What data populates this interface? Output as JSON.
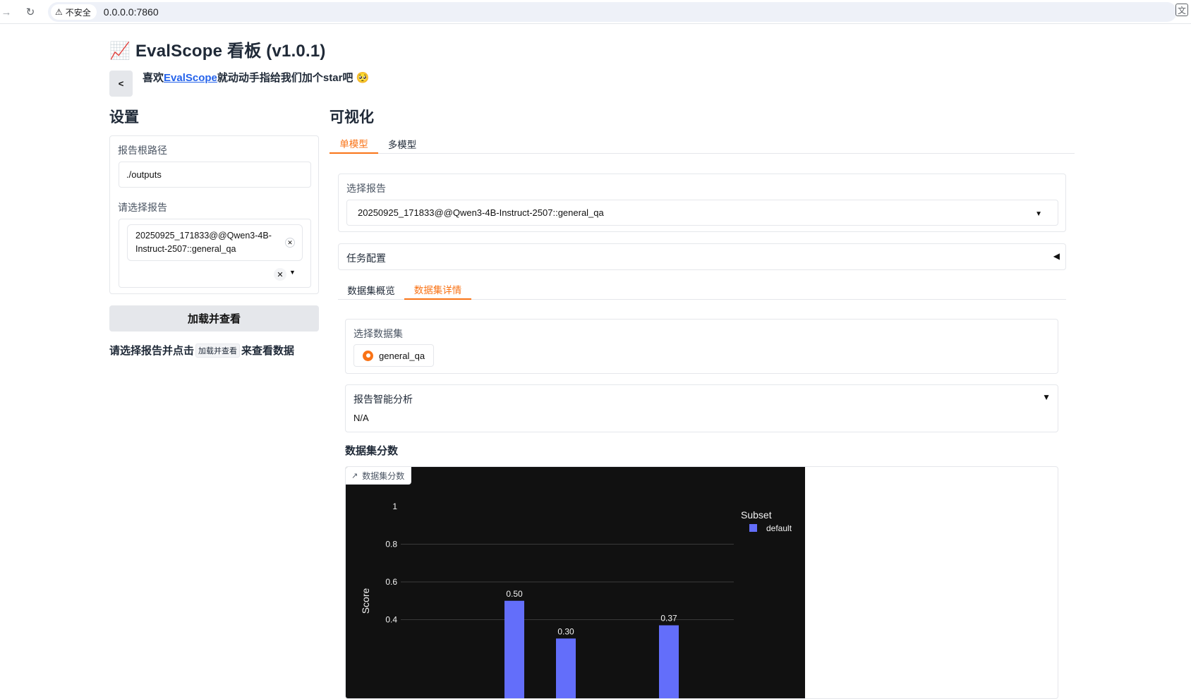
{
  "browser": {
    "security_label": "不安全",
    "url": "0.0.0.0:7860"
  },
  "header": {
    "title": "📈 EvalScope 看板 (v1.0.1)",
    "collapse_label": "<",
    "star_prefix": "喜欢",
    "star_link": "EvalScope",
    "star_suffix": "就动动手指给我们加个star吧 🥺"
  },
  "settings": {
    "title": "设置",
    "root_path_label": "报告根路径",
    "root_path_value": "./outputs",
    "select_report_label": "请选择报告",
    "selected_report": "20250925_171833@@Qwen3-4B-Instruct-2507::general_qa",
    "load_button": "加载并查看",
    "hint_prefix": "请选择报告并点击",
    "hint_code": "加载并查看",
    "hint_suffix": "来查看数据"
  },
  "visualization": {
    "title": "可视化",
    "tabs": [
      "单模型",
      "多模型"
    ],
    "active_tab": 0,
    "report_select_label": "选择报告",
    "report_select_value": "20250925_171833@@Qwen3-4B-Instruct-2507::general_qa",
    "task_config_label": "任务配置",
    "sub_tabs": [
      "数据集概览",
      "数据集详情"
    ],
    "active_sub_tab": 1,
    "dataset_select_label": "选择数据集",
    "dataset_option": "general_qa",
    "analysis_label": "报告智能分析",
    "analysis_value": "N/A",
    "score_section_label": "数据集分数",
    "plot_badge": "数据集分数"
  },
  "colors": {
    "accent": "#f97316",
    "bar": "#636efa",
    "plot_bg": "#111111",
    "link": "#2563eb"
  },
  "chart_data": {
    "type": "bar",
    "ylabel": "Score",
    "ylim": [
      0,
      1
    ],
    "yticks": [
      "1",
      "0.8",
      "0.6",
      "0.4"
    ],
    "legend_title": "Subset",
    "legend_placement": "top-right",
    "series": [
      {
        "name": "default",
        "values": [
          0.5,
          0.3,
          0.37
        ]
      }
    ],
    "data_labels": [
      "0.50",
      "0.30",
      "0.37"
    ],
    "grid": true
  }
}
